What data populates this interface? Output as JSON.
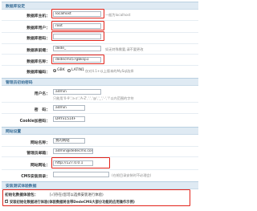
{
  "db_section": {
    "title": "数据库设定",
    "host_label": "数据库主机：",
    "host_value": "localhost",
    "host_hint": "一般为localhost",
    "user_label": "数据库用户：",
    "user_value": "root",
    "password_label": "数据库密码：",
    "password_value": "",
    "prefix_label": "数据表前缀：",
    "prefix_value": "dede_",
    "prefix_hint": "如无特殊需要,请不要更改",
    "dbname_label": "数据库名称：",
    "dbname_value": "dedecms57gbksp1",
    "encoding_label": "数据库编码：",
    "encoding_opt1": "GBK",
    "encoding_opt2": "LATIN1",
    "encoding_hint": "仅对4.1+以上版本的MySql选择"
  },
  "admin_section": {
    "title": "管理员初始密码",
    "username_label": "用户名：",
    "username_value": "admin",
    "username_hint": "只能用'0-9','a-z','A-Z','.','@','_','-','!'以内范围的字符",
    "password_label": "密　码：",
    "password_value": "admin",
    "cookie_label": "Cookie加密码：",
    "cookie_value": "DRYx1514F"
  },
  "site_section": {
    "title": "网站设置",
    "sitename_label": "网站名称：",
    "sitename_value": "我的网站",
    "email_label": "管理员邮箱：",
    "email_value": "admin@dedecms.com",
    "url_label": "网站网址：",
    "url_value": "http://127.0.0.1",
    "cms_label": "CMS安装目录：",
    "cms_value": "",
    "cms_hint": "(在根目录安装时不必理会)"
  },
  "modules_section": {
    "title": "安装测试体验数据",
    "init_label": "初始化数据体验包：",
    "init_option": "[√]存在(您可以选择安装进行体验)",
    "remote_option": "安装初始化数据进行体验(体验数据将含带DedeCMS大部分功能的应用操作示例)"
  },
  "colors": {
    "header_bg": "#dfeaf3",
    "header_text": "#3a6f98",
    "highlight": "#e2231a"
  }
}
